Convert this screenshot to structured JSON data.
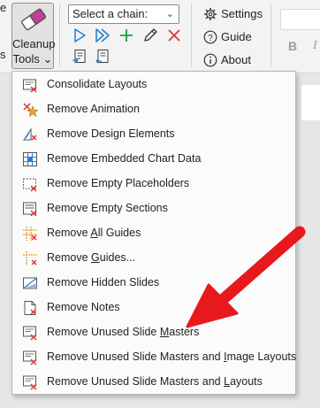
{
  "ribbon": {
    "cleanup_tools": {
      "label_line1": "Cleanup",
      "label_line2": "Tools",
      "chevron": "⌄"
    },
    "chain_select": {
      "value": "Select a chain:"
    },
    "settings": {
      "label": "Settings"
    },
    "guide": {
      "label": "Guide"
    },
    "about": {
      "label": "About"
    },
    "edge_text_top": "e",
    "edge_text_bottom": "s",
    "bold_glyph": "B",
    "italic_glyph": "I"
  },
  "menu": {
    "items": [
      {
        "pre": "Consolidate Layouts",
        "key": "",
        "post": "",
        "icon": "consolidate-layouts-icon"
      },
      {
        "pre": "Remove Animation",
        "key": "",
        "post": "",
        "icon": "remove-animation-icon"
      },
      {
        "pre": "Remove Design Elements",
        "key": "",
        "post": "",
        "icon": "remove-design-elements-icon"
      },
      {
        "pre": "Remove Embedded Chart Data",
        "key": "",
        "post": "",
        "icon": "remove-chart-data-icon"
      },
      {
        "pre": "Remove Empty Placeholders",
        "key": "",
        "post": "",
        "icon": "remove-placeholders-icon"
      },
      {
        "pre": "Remove Empty Sections",
        "key": "",
        "post": "",
        "icon": "remove-sections-icon"
      },
      {
        "pre": "Remove ",
        "key": "A",
        "post": "ll Guides",
        "icon": "remove-all-guides-icon"
      },
      {
        "pre": "Remove ",
        "key": "G",
        "post": "uides...",
        "icon": "remove-guides-icon"
      },
      {
        "pre": "Remove Hidden Slides",
        "key": "",
        "post": "",
        "icon": "remove-hidden-slides-icon"
      },
      {
        "pre": "Remove Notes",
        "key": "",
        "post": "",
        "icon": "remove-notes-icon"
      },
      {
        "pre": "Remove Unused Slide ",
        "key": "M",
        "post": "asters",
        "icon": "remove-unused-masters-icon"
      },
      {
        "pre": "Remove Unused Slide Masters and ",
        "key": "I",
        "post": "mage Layouts",
        "icon": "remove-masters-image-layouts-icon"
      },
      {
        "pre": "Remove Unused Slide Masters and ",
        "key": "L",
        "post": "ayouts",
        "icon": "remove-masters-layouts-icon"
      }
    ]
  },
  "colors": {
    "accent_blue": "#2b7fd6",
    "add_green": "#1b9e3e",
    "remove_red": "#e3323a",
    "arrow_red": "#e8191d"
  }
}
